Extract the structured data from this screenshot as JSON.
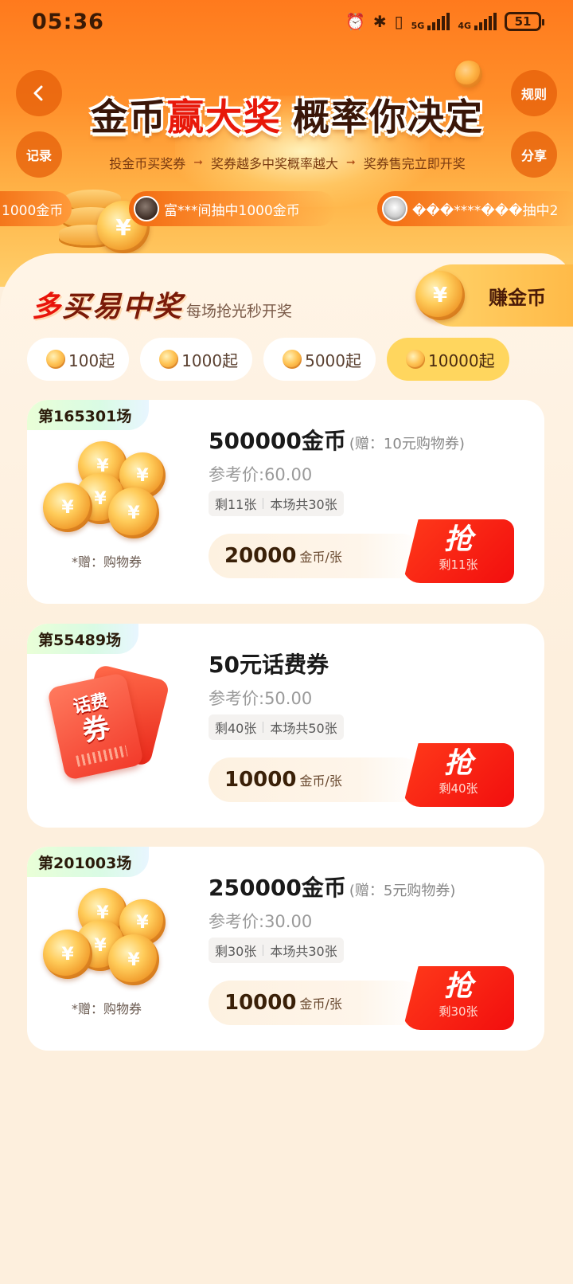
{
  "status_bar": {
    "time": "05:36",
    "network_1": "5G",
    "network_2": "4G",
    "battery": "51"
  },
  "header": {
    "back_icon": "chevron-left-icon",
    "record_label": "记录",
    "rules_label": "规则",
    "share_label": "分享",
    "title_part1": "金币",
    "title_highlight": "赢大奖",
    "title_part2": "概率你决定",
    "steps": [
      "投金币买奖券",
      "奖券越多中奖概率越大",
      "奖券售完立即开奖"
    ],
    "ticker": [
      "1000金币",
      "富***间抽中1000金币",
      "���****���抽中2"
    ]
  },
  "section": {
    "title_first": "多",
    "title_rest": "买易中奖",
    "subtitle": "每场抢光秒开奖",
    "earn_button": "赚金币",
    "coin_symbol": "¥"
  },
  "filters": [
    {
      "label": "100起",
      "active": false
    },
    {
      "label": "1000起",
      "active": false
    },
    {
      "label": "5000起",
      "active": false
    },
    {
      "label": "10000起",
      "active": true
    }
  ],
  "cards": [
    {
      "round": "第165301场",
      "name": "500000金币",
      "gift": "(赠：10元购物券)",
      "ref_price": "参考价:60.00",
      "remaining": "剩11张",
      "total": "本场共30张",
      "gift_note": "*赠：购物券",
      "price": "20000",
      "unit": "金币/张",
      "grab": "抢",
      "grab_remaining": "剩11张"
    },
    {
      "round": "第55489场",
      "name": "50元话费券",
      "gift": "",
      "ref_price": "参考价:50.00",
      "remaining": "剩40张",
      "total": "本场共50张",
      "gift_note": "",
      "voucher_line1": "话费",
      "voucher_line2": "券",
      "price": "10000",
      "unit": "金币/张",
      "grab": "抢",
      "grab_remaining": "剩40张"
    },
    {
      "round": "第201003场",
      "name": "250000金币",
      "gift": "(赠：5元购物券)",
      "ref_price": "参考价:30.00",
      "remaining": "剩30张",
      "total": "本场共30张",
      "gift_note": "*赠：购物券",
      "price": "10000",
      "unit": "金币/张",
      "grab": "抢",
      "grab_remaining": "剩30张"
    }
  ],
  "colors": {
    "header_orange": "#ff7a1d",
    "accent_red": "#f20e0e",
    "gold": "#ffd65e",
    "background": "#fdefdd"
  }
}
